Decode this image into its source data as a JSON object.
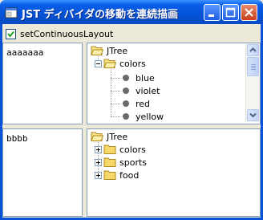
{
  "window": {
    "title": "JST ディバイダの移動を連続描画",
    "buttons": {
      "minimize_icon": "minimize-icon",
      "maximize_icon": "maximize-icon",
      "close_icon": "close-icon"
    }
  },
  "toolbar": {
    "checkbox_label": "setContinuousLayout",
    "checkbox_checked": true
  },
  "top": {
    "left_text": "aaaaaaa",
    "tree": {
      "root": "JTree",
      "folder": "colors",
      "leaves": [
        "blue",
        "violet",
        "red",
        "yellow"
      ]
    }
  },
  "bottom": {
    "left_text": "bbbb",
    "tree": {
      "root": "JTree",
      "folders": [
        "colors",
        "sports",
        "food"
      ]
    }
  },
  "colors": {
    "titlebar": "#0a5fe8",
    "border": "#7f9db9",
    "checkbox_mark": "#21a121"
  }
}
